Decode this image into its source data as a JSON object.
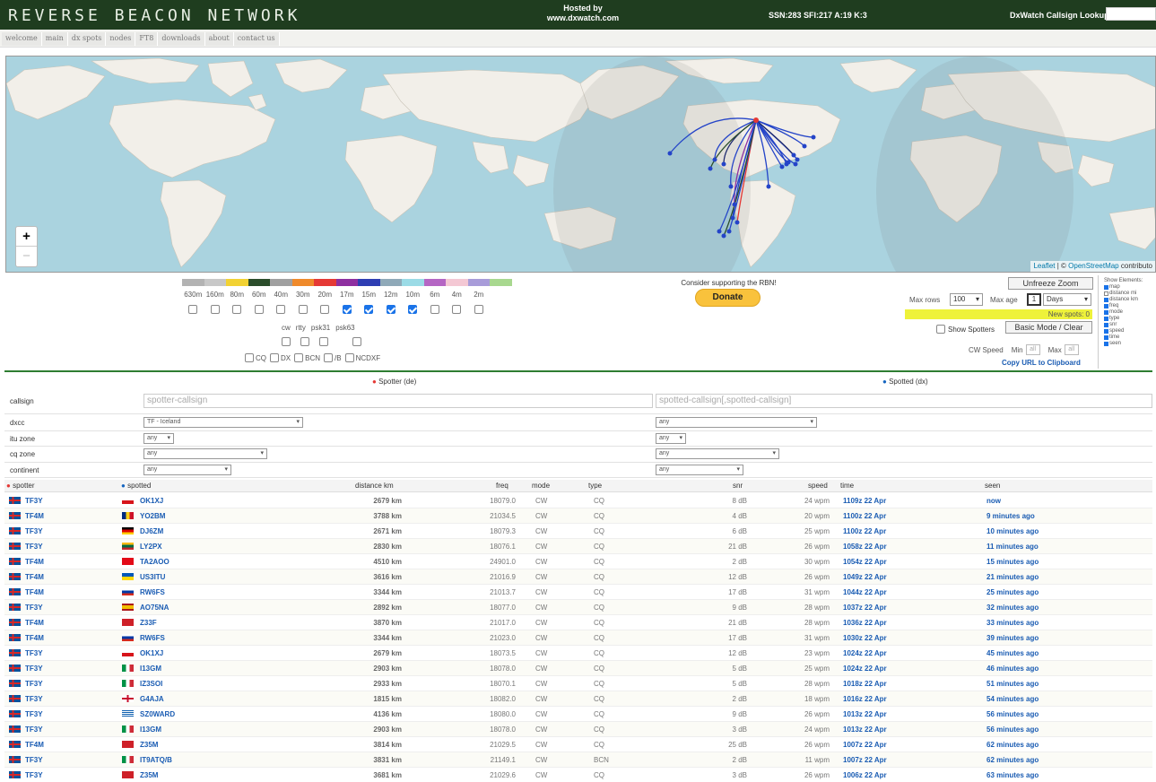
{
  "header": {
    "logo": "REVERSE BEACON NETWORK",
    "hosted_line1": "Hosted by",
    "hosted_line2": "www.dxwatch.com",
    "sfi": "SSN:283 SFI:217 A:19 K:3",
    "lookup_label": "DxWatch Callsign Lookup:"
  },
  "nav": [
    "welcome",
    "main",
    "dx spots",
    "nodes",
    "FT8",
    "downloads",
    "about",
    "contact us"
  ],
  "map": {
    "zoom_in": "+",
    "zoom_out": "−",
    "attrib_leaflet": "Leaflet",
    "attrib_sep": " | © ",
    "attrib_osm": "OpenStreetMap",
    "attrib_tail": " contributo"
  },
  "bands": {
    "labels": [
      "630m",
      "160m",
      "80m",
      "60m",
      "40m",
      "30m",
      "20m",
      "17m",
      "15m",
      "12m",
      "10m",
      "6m",
      "4m",
      "2m"
    ],
    "colors": [
      "#b3b3b3",
      "#c8c8c8",
      "#f2d233",
      "#2b4d2b",
      "#a0a0a0",
      "#ef8a2b",
      "#e53935",
      "#8e2fa0",
      "#2e3eb3",
      "#8fa9b8",
      "#9bdbe6",
      "#b566c4",
      "#f4c8d4",
      "#a89cd9",
      "#a8d88f"
    ],
    "checked": [
      false,
      false,
      false,
      false,
      false,
      false,
      false,
      true,
      true,
      true,
      true,
      false,
      false,
      false
    ]
  },
  "modes": {
    "labels": [
      "cw",
      "rtty",
      "psk31",
      "psk63"
    ]
  },
  "types": [
    "CQ",
    "DX",
    "BCN",
    "/B",
    "NCDXF"
  ],
  "donate": {
    "support_text": "Consider supporting the RBN!",
    "button": "Donate"
  },
  "controls": {
    "unfreeze": "Unfreeze Zoom",
    "maxrows_label": "Max rows",
    "maxrows_value": "100",
    "maxage_label": "Max age",
    "maxage_value": "1",
    "ageunit": "Days",
    "newspots": "New spots: 0",
    "show_spotters": "Show Spotters",
    "basic_mode": "Basic Mode / Clear",
    "cw_speed": "CW Speed",
    "min": "Min",
    "max": "Max",
    "all": "all",
    "copy_url": "Copy URL to Clipboard"
  },
  "show_elements": {
    "title": "Show Elements:",
    "items": [
      {
        "label": "map",
        "on": true
      },
      {
        "label": "distance mi",
        "on": false
      },
      {
        "label": "distance km",
        "on": true
      },
      {
        "label": "freq",
        "on": true
      },
      {
        "label": "mode",
        "on": true
      },
      {
        "label": "type",
        "on": true
      },
      {
        "label": "snr",
        "on": true
      },
      {
        "label": "speed",
        "on": true
      },
      {
        "label": "time",
        "on": true
      },
      {
        "label": "seen",
        "on": true
      }
    ]
  },
  "filters": {
    "spotter_head": "Spotter (de)",
    "spotted_head": "Spotted (dx)",
    "callsign_label": "callsign",
    "spotter_placeholder": "spotter-callsign",
    "spotted_placeholder": "spotted-callsign[,spotted-callsign]",
    "dxcc_label": "dxcc",
    "dxcc_spotter": "TF - Iceland",
    "dxcc_spotted": "any",
    "itu_label": "itu zone",
    "itu_spotter": "any",
    "itu_spotted": "any",
    "cq_label": "cq zone",
    "cq_spotter": "any",
    "cq_spotted": "any",
    "continent_label": "continent",
    "continent_spotter": "any",
    "continent_spotted": "any"
  },
  "table": {
    "headers": {
      "spotter": "spotter",
      "spotted": "spotted",
      "distance": "distance km",
      "freq": "freq",
      "mode": "mode",
      "type": "type",
      "snr": "snr",
      "speed": "speed",
      "time": "time",
      "seen": "seen"
    },
    "rows": [
      {
        "spotter": "TF3Y",
        "spotted": "OK1XJ",
        "flag": "cz",
        "distance": "2679 km",
        "freq": "18079.0",
        "mode": "CW",
        "type": "CQ",
        "snr": "8 dB",
        "speed": "24 wpm",
        "time": "1109z 22 Apr",
        "seen": "now"
      },
      {
        "spotter": "TF4M",
        "spotted": "YO2BM",
        "flag": "ro",
        "distance": "3788 km",
        "freq": "21034.5",
        "mode": "CW",
        "type": "CQ",
        "snr": "4 dB",
        "speed": "20 wpm",
        "time": "1100z 22 Apr",
        "seen": "9 minutes ago"
      },
      {
        "spotter": "TF3Y",
        "spotted": "DJ6ZM",
        "flag": "de",
        "distance": "2671 km",
        "freq": "18079.3",
        "mode": "CW",
        "type": "CQ",
        "snr": "6 dB",
        "speed": "25 wpm",
        "time": "1100z 22 Apr",
        "seen": "10 minutes ago"
      },
      {
        "spotter": "TF3Y",
        "spotted": "LY2PX",
        "flag": "lt",
        "distance": "2830 km",
        "freq": "18076.1",
        "mode": "CW",
        "type": "CQ",
        "snr": "21 dB",
        "speed": "26 wpm",
        "time": "1058z 22 Apr",
        "seen": "11 minutes ago"
      },
      {
        "spotter": "TF4M",
        "spotted": "TA2AOO",
        "flag": "tr",
        "distance": "4510 km",
        "freq": "24901.0",
        "mode": "CW",
        "type": "CQ",
        "snr": "2 dB",
        "speed": "30 wpm",
        "time": "1054z 22 Apr",
        "seen": "15 minutes ago"
      },
      {
        "spotter": "TF4M",
        "spotted": "US3ITU",
        "flag": "ua",
        "distance": "3616 km",
        "freq": "21016.9",
        "mode": "CW",
        "type": "CQ",
        "snr": "12 dB",
        "speed": "26 wpm",
        "time": "1049z 22 Apr",
        "seen": "21 minutes ago"
      },
      {
        "spotter": "TF4M",
        "spotted": "RW6FS",
        "flag": "ru",
        "distance": "3344 km",
        "freq": "21013.7",
        "mode": "CW",
        "type": "CQ",
        "snr": "17 dB",
        "speed": "31 wpm",
        "time": "1044z 22 Apr",
        "seen": "25 minutes ago"
      },
      {
        "spotter": "TF3Y",
        "spotted": "AO75NA",
        "flag": "es",
        "distance": "2892 km",
        "freq": "18077.0",
        "mode": "CW",
        "type": "CQ",
        "snr": "9 dB",
        "speed": "28 wpm",
        "time": "1037z 22 Apr",
        "seen": "32 minutes ago"
      },
      {
        "spotter": "TF4M",
        "spotted": "Z33F",
        "flag": "mk",
        "distance": "3870 km",
        "freq": "21017.0",
        "mode": "CW",
        "type": "CQ",
        "snr": "21 dB",
        "speed": "28 wpm",
        "time": "1036z 22 Apr",
        "seen": "33 minutes ago"
      },
      {
        "spotter": "TF4M",
        "spotted": "RW6FS",
        "flag": "ru",
        "distance": "3344 km",
        "freq": "21023.0",
        "mode": "CW",
        "type": "CQ",
        "snr": "17 dB",
        "speed": "31 wpm",
        "time": "1030z 22 Apr",
        "seen": "39 minutes ago"
      },
      {
        "spotter": "TF3Y",
        "spotted": "OK1XJ",
        "flag": "cz",
        "distance": "2679 km",
        "freq": "18073.5",
        "mode": "CW",
        "type": "CQ",
        "snr": "12 dB",
        "speed": "23 wpm",
        "time": "1024z 22 Apr",
        "seen": "45 minutes ago"
      },
      {
        "spotter": "TF3Y",
        "spotted": "I13GM",
        "flag": "it",
        "distance": "2903 km",
        "freq": "18078.0",
        "mode": "CW",
        "type": "CQ",
        "snr": "5 dB",
        "speed": "25 wpm",
        "time": "1024z 22 Apr",
        "seen": "46 minutes ago"
      },
      {
        "spotter": "TF3Y",
        "spotted": "IZ3SOI",
        "flag": "it",
        "distance": "2933 km",
        "freq": "18070.1",
        "mode": "CW",
        "type": "CQ",
        "snr": "5 dB",
        "speed": "28 wpm",
        "time": "1018z 22 Apr",
        "seen": "51 minutes ago"
      },
      {
        "spotter": "TF3Y",
        "spotted": "G4AJA",
        "flag": "gb",
        "distance": "1815 km",
        "freq": "18082.0",
        "mode": "CW",
        "type": "CQ",
        "snr": "2 dB",
        "speed": "18 wpm",
        "time": "1016z 22 Apr",
        "seen": "54 minutes ago"
      },
      {
        "spotter": "TF3Y",
        "spotted": "SZ0WARD",
        "flag": "gr",
        "distance": "4136 km",
        "freq": "18080.0",
        "mode": "CW",
        "type": "CQ",
        "snr": "9 dB",
        "speed": "26 wpm",
        "time": "1013z 22 Apr",
        "seen": "56 minutes ago"
      },
      {
        "spotter": "TF3Y",
        "spotted": "I13GM",
        "flag": "it",
        "distance": "2903 km",
        "freq": "18078.0",
        "mode": "CW",
        "type": "CQ",
        "snr": "3 dB",
        "speed": "24 wpm",
        "time": "1013z 22 Apr",
        "seen": "56 minutes ago"
      },
      {
        "spotter": "TF4M",
        "spotted": "Z35M",
        "flag": "mk",
        "distance": "3814 km",
        "freq": "21029.5",
        "mode": "CW",
        "type": "CQ",
        "snr": "25 dB",
        "speed": "26 wpm",
        "time": "1007z 22 Apr",
        "seen": "62 minutes ago"
      },
      {
        "spotter": "TF3Y",
        "spotted": "IT9ATQ/B",
        "flag": "it",
        "distance": "3831 km",
        "freq": "21149.1",
        "mode": "CW",
        "type": "BCN",
        "snr": "2 dB",
        "speed": "11 wpm",
        "time": "1007z 22 Apr",
        "seen": "62 minutes ago"
      },
      {
        "spotter": "TF3Y",
        "spotted": "Z35M",
        "flag": "mk",
        "distance": "3681 km",
        "freq": "21029.6",
        "mode": "CW",
        "type": "CQ",
        "snr": "3 dB",
        "speed": "26 wpm",
        "time": "1006z 22 Apr",
        "seen": "63 minutes ago"
      }
    ]
  }
}
